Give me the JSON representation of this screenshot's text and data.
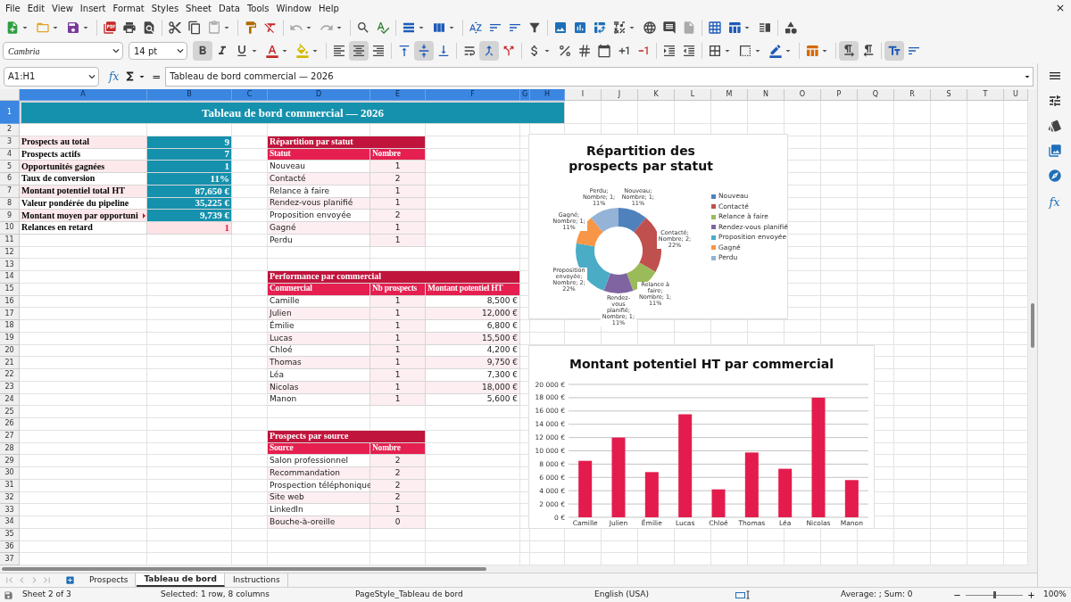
{
  "menu": [
    "File",
    "Edit",
    "View",
    "Insert",
    "Format",
    "Styles",
    "Sheet",
    "Data",
    "Tools",
    "Window",
    "Help"
  ],
  "format_toolbar": {
    "font": "Cambria",
    "size": "14 pt",
    "bold": true,
    "italic": false,
    "underline": false,
    "align_left": false,
    "align_center": true,
    "align_right": false,
    "align_top": false,
    "align_middle": true,
    "align_bottom": false,
    "merged": true,
    "ltr": true,
    "fit_text": true
  },
  "formula_bar": {
    "name_box": "A1:H1",
    "wizard": "fx",
    "equals": "=",
    "content": "Tableau de bord commercial — 2026"
  },
  "column_headers": [
    {
      "label": "A",
      "selected": true
    },
    {
      "label": "B",
      "selected": true
    },
    {
      "label": "C",
      "selected": true
    },
    {
      "label": "D",
      "selected": true
    },
    {
      "label": "E",
      "selected": true
    },
    {
      "label": "F",
      "selected": true
    },
    {
      "label": "G",
      "selected": true
    },
    {
      "label": "H",
      "selected": true
    },
    {
      "label": "I",
      "selected": false
    },
    {
      "label": "J",
      "selected": false
    },
    {
      "label": "K",
      "selected": false
    },
    {
      "label": "L",
      "selected": false
    },
    {
      "label": "M",
      "selected": false
    },
    {
      "label": "N",
      "selected": false
    },
    {
      "label": "O",
      "selected": false
    },
    {
      "label": "P",
      "selected": false
    },
    {
      "label": "Q",
      "selected": false
    },
    {
      "label": "R",
      "selected": false
    },
    {
      "label": "S",
      "selected": false
    },
    {
      "label": "T",
      "selected": false
    },
    {
      "label": "U",
      "selected": false
    }
  ],
  "row_headers": [
    {
      "label": "1",
      "selected": true
    },
    {
      "label": "2",
      "selected": false
    },
    {
      "label": "3",
      "selected": false
    },
    {
      "label": "4",
      "selected": false
    },
    {
      "label": "5",
      "selected": false
    },
    {
      "label": "6",
      "selected": false
    },
    {
      "label": "7",
      "selected": false
    },
    {
      "label": "8",
      "selected": false
    },
    {
      "label": "9",
      "selected": false
    },
    {
      "label": "10",
      "selected": false
    },
    {
      "label": "11",
      "selected": false
    },
    {
      "label": "12",
      "selected": false
    },
    {
      "label": "13",
      "selected": false
    },
    {
      "label": "14",
      "selected": false
    },
    {
      "label": "15",
      "selected": false
    },
    {
      "label": "16",
      "selected": false
    },
    {
      "label": "17",
      "selected": false
    },
    {
      "label": "18",
      "selected": false
    },
    {
      "label": "19",
      "selected": false
    },
    {
      "label": "20",
      "selected": false
    },
    {
      "label": "21",
      "selected": false
    },
    {
      "label": "22",
      "selected": false
    },
    {
      "label": "23",
      "selected": false
    },
    {
      "label": "24",
      "selected": false
    },
    {
      "label": "25",
      "selected": false
    },
    {
      "label": "26",
      "selected": false
    },
    {
      "label": "27",
      "selected": false
    },
    {
      "label": "28",
      "selected": false
    },
    {
      "label": "29",
      "selected": false
    },
    {
      "label": "30",
      "selected": false
    },
    {
      "label": "31",
      "selected": false
    },
    {
      "label": "32",
      "selected": false
    },
    {
      "label": "33",
      "selected": false
    },
    {
      "label": "34",
      "selected": false
    },
    {
      "label": "35",
      "selected": false
    },
    {
      "label": "36",
      "selected": false
    },
    {
      "label": "37",
      "selected": false
    }
  ],
  "title": "Tableau de bord commercial — 2026",
  "kpis": [
    {
      "label": "Prospects au total",
      "value": "9",
      "kind": "metric",
      "clipped": false
    },
    {
      "label": "Prospects actifs",
      "value": "7",
      "kind": "metric",
      "clipped": false
    },
    {
      "label": "Opportunités gagnées",
      "value": "1",
      "kind": "metric",
      "clipped": false
    },
    {
      "label": "Taux de conversion",
      "value": "11%",
      "kind": "metric",
      "clipped": false
    },
    {
      "label": "Montant potentiel total HT",
      "value": "87,650 €",
      "kind": "metric",
      "clipped": false
    },
    {
      "label": "Valeur pondérée du pipeline",
      "value": "35,225 €",
      "kind": "metric",
      "clipped": false
    },
    {
      "label": "Montant moyen par opportuni",
      "value": "9,739 €",
      "kind": "metric",
      "clipped": true
    },
    {
      "label": "Relances en retard",
      "value": "1",
      "kind": "alert",
      "clipped": false
    }
  ],
  "status_table": {
    "title": "Répartition par statut",
    "headers": [
      "Statut",
      "Nombre"
    ],
    "rows": [
      [
        "Nouveau",
        "1"
      ],
      [
        "Contacté",
        "2"
      ],
      [
        "Relance à faire",
        "1"
      ],
      [
        "Rendez-vous planifié",
        "1"
      ],
      [
        "Proposition envoyée",
        "2"
      ],
      [
        "Gagné",
        "1"
      ],
      [
        "Perdu",
        "1"
      ]
    ]
  },
  "sales_table": {
    "title": "Performance par commercial",
    "headers": [
      "Commercial",
      "Nb prospects",
      "Montant potentiel HT"
    ],
    "rows": [
      [
        "Camille",
        "1",
        "8,500 €"
      ],
      [
        "Julien",
        "1",
        "12,000 €"
      ],
      [
        "Émilie",
        "1",
        "6,800 €"
      ],
      [
        "Lucas",
        "1",
        "15,500 €"
      ],
      [
        "Chloé",
        "1",
        "4,200 €"
      ],
      [
        "Thomas",
        "1",
        "9,750 €"
      ],
      [
        "Léa",
        "1",
        "7,300 €"
      ],
      [
        "Nicolas",
        "1",
        "18,000 €"
      ],
      [
        "Manon",
        "1",
        "5,600 €"
      ]
    ]
  },
  "source_table": {
    "title": "Prospects par source",
    "headers": [
      "Source",
      "Nombre"
    ],
    "rows": [
      [
        "Salon professionnel",
        "2"
      ],
      [
        "Recommandation",
        "2"
      ],
      [
        "Prospection téléphonique",
        "2"
      ],
      [
        "Site web",
        "2"
      ],
      [
        "LinkedIn",
        "1"
      ],
      [
        "Bouche-à-oreille",
        "0"
      ]
    ]
  },
  "status_chart": {
    "chart_data": {
      "type": "donut",
      "title": "Répartition des prospects par statut",
      "categories": [
        "Nouveau",
        "Contacté",
        "Relance à faire",
        "Rendez-vous planifié",
        "Proposition envoyée",
        "Gagné",
        "Perdu"
      ],
      "series": [
        {
          "values": [
            11,
            22,
            11,
            11,
            22,
            11,
            11
          ]
        }
      ],
      "legend": true,
      "colors": [
        "#4f81bd",
        "#c0504d",
        "#9bbb59",
        "#8064a2",
        "#4bacc6",
        "#f79646",
        "#95b3d7"
      ],
      "value_labels": [
        "Nouveau; Nombre; 1; 11%",
        "Contacté; Nombre; 2; 22%",
        "Relance à faire; Nombre; 1; 11%",
        "Rendez-vous planifié; Nombre; 1; 11%",
        "Proposition envoyée; Nombre; 2; 22%",
        "Gagné; Nombre; 1; 11%",
        "Perdu; Nombre; 1; 11%"
      ]
    }
  },
  "sales_chart": {
    "chart_data": {
      "type": "bar",
      "title": "Montant potentiel HT par commercial",
      "categories": [
        "Camille",
        "Julien",
        "Émilie",
        "Lucas",
        "Chloé",
        "Thomas",
        "Léa",
        "Nicolas",
        "Manon"
      ],
      "grid": true,
      "series": [
        {
          "color": "#e31c4d",
          "values": [
            8500,
            12000,
            6800,
            15500,
            4200,
            9750,
            7300,
            18000,
            5600
          ]
        }
      ],
      "ylim": [
        0,
        20000
      ],
      "yticks": [
        {
          "value": 0,
          "label": "0 €"
        },
        {
          "value": 2000,
          "label": "2 000 €"
        },
        {
          "value": 4000,
          "label": "4 000 €"
        },
        {
          "value": 6000,
          "label": "6 000 €"
        },
        {
          "value": 8000,
          "label": "8 000 €"
        },
        {
          "value": 10000,
          "label": "10 000 €"
        },
        {
          "value": 12000,
          "label": "12 000 €"
        },
        {
          "value": 14000,
          "label": "14 000 €"
        },
        {
          "value": 16000,
          "label": "16 000 €"
        },
        {
          "value": 18000,
          "label": "18 000 €"
        },
        {
          "value": 20000,
          "label": "20 000 €"
        }
      ]
    }
  },
  "sheet_tabs": [
    {
      "label": "Prospects",
      "selected": false
    },
    {
      "label": "Tableau de bord",
      "selected": true
    },
    {
      "label": "Instructions",
      "selected": false
    }
  ],
  "status_bar": {
    "sheet": "Sheet 2 of 3",
    "selection": "Selected: 1 row, 8 columns",
    "page_style": "PageStyle_Tableau de bord",
    "language": "English (USA)",
    "summary": "Average: ; Sum: 0",
    "zoom": {
      "level": 0.5
    },
    "zoom_label": "100%"
  },
  "sidebar": {
    "functions_label": "fx"
  }
}
